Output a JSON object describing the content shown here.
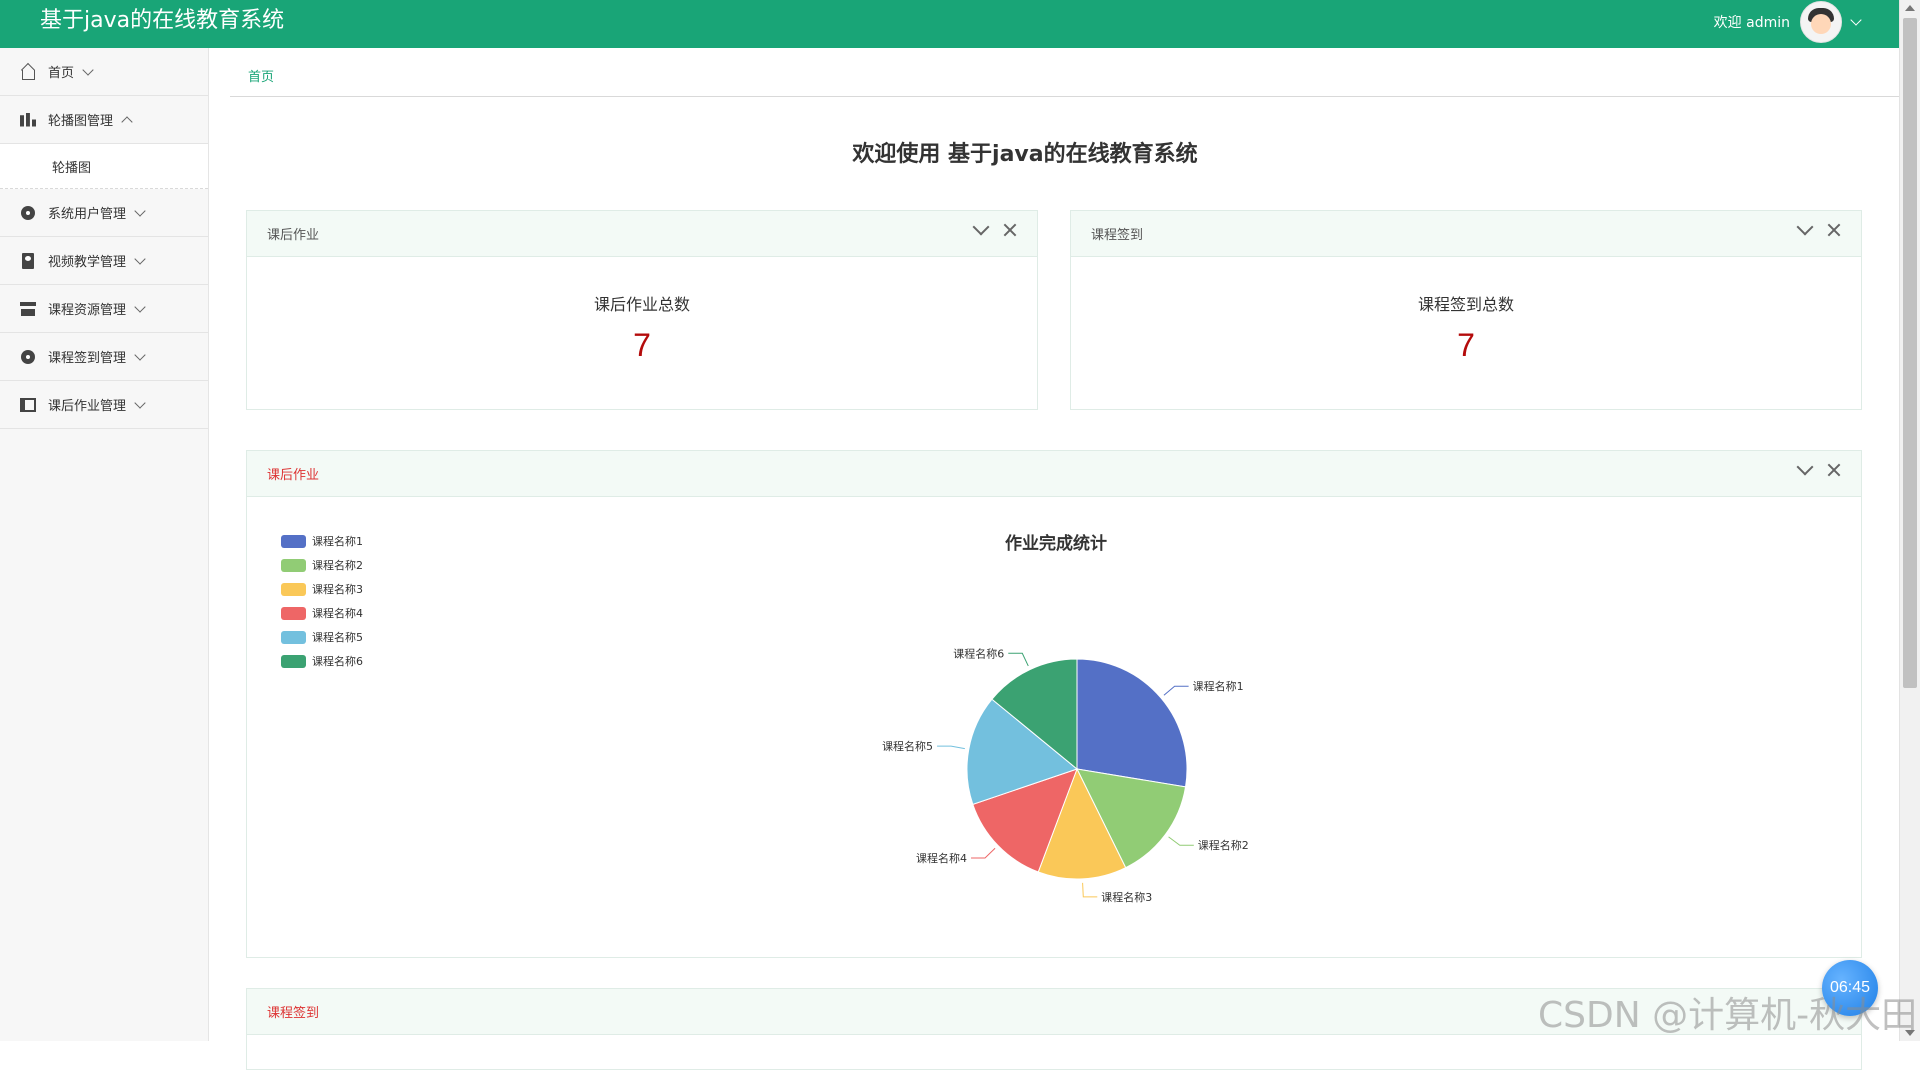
{
  "header": {
    "app_title": "基于java的在线教育系统",
    "welcome": "欢迎 admin"
  },
  "sidebar": {
    "items": [
      {
        "label": "首页",
        "icon": "home-icon"
      },
      {
        "label": "轮播图管理",
        "icon": "bar-chart-icon",
        "expanded": true
      },
      {
        "label": "系统用户管理",
        "icon": "user-circle-icon"
      },
      {
        "label": "视频教学管理",
        "icon": "video-book-icon"
      },
      {
        "label": "课程资源管理",
        "icon": "archive-icon"
      },
      {
        "label": "课程签到管理",
        "icon": "checkin-icon"
      },
      {
        "label": "课后作业管理",
        "icon": "panel-icon"
      }
    ],
    "submenu": {
      "label": "轮播图"
    }
  },
  "breadcrumb": {
    "home": "首页"
  },
  "page_title": "欢迎使用 基于java的在线教育系统",
  "cards": {
    "homework": {
      "header": "课后作业",
      "label": "课后作业总数",
      "value": "7"
    },
    "checkin": {
      "header": "课程签到",
      "label": "课程签到总数",
      "value": "7"
    }
  },
  "chart_panel": {
    "header": "课后作业"
  },
  "bottom_panel": {
    "header": "课程签到"
  },
  "chart_data": {
    "type": "pie",
    "title": "作业完成统计",
    "categories": [
      "课程名称1",
      "课程名称2",
      "课程名称3",
      "课程名称4",
      "课程名称5",
      "课程名称6"
    ],
    "values": [
      26.5,
      14.5,
      12.5,
      13.5,
      15.5,
      13.5
    ],
    "colors": [
      "#5470c6",
      "#91cc75",
      "#fac858",
      "#ee6666",
      "#73c0de",
      "#3ba272"
    ],
    "legend": "top-left"
  },
  "clock": {
    "time": "06:45"
  },
  "watermark": "CSDN @计算机-秋大田"
}
